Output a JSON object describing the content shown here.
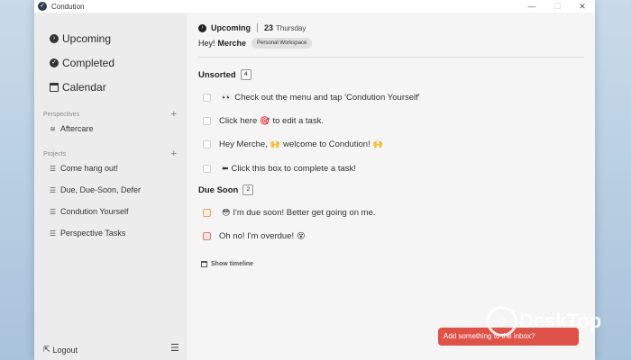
{
  "window": {
    "title": "Condution",
    "controls": {
      "minimize": "—",
      "maximize": "☐",
      "close": "✕"
    }
  },
  "sidebar": {
    "nav": [
      {
        "label": "Upcoming",
        "icon": "upcoming-icon"
      },
      {
        "label": "Completed",
        "icon": "completed-icon"
      },
      {
        "label": "Calendar",
        "icon": "calendar-icon"
      }
    ],
    "perspectives": {
      "heading": "Perspectives",
      "add": "+",
      "items": [
        {
          "label": "Aftercare",
          "icon": "layers-icon"
        }
      ]
    },
    "projects": {
      "heading": "Projects",
      "add": "+",
      "items": [
        {
          "label": "Come hang out!",
          "icon": "list-icon"
        },
        {
          "label": "Due, Due-Soon, Defer",
          "icon": "list-icon"
        },
        {
          "label": "Condution Yourself",
          "icon": "list-icon"
        },
        {
          "label": "Perspective Tasks",
          "icon": "list-icon"
        }
      ]
    },
    "logout": "Logout"
  },
  "header": {
    "title": "Upcoming",
    "day": "23",
    "weekday": "Thursday",
    "greeting": "Hey!",
    "user": "Merche",
    "workspace": "Personal Workspace"
  },
  "groups": {
    "unsorted": {
      "title": "Unsorted",
      "count": "4",
      "tasks": [
        {
          "pre": "👀",
          "text": "Check out the menu and tap 'Condution Yourself'",
          "post": ""
        },
        {
          "pre": "",
          "text": "Click here",
          "emoji": "🎯",
          "after": "to edit a task."
        },
        {
          "pre": "",
          "text": "Hey Merche,",
          "emoji": "🙌",
          "after": "welcome to Condution!",
          "post": "🙌"
        },
        {
          "pre": "⬅",
          "text": "Click this box to complete a task!",
          "post": ""
        }
      ]
    },
    "due_soon": {
      "title": "Due Soon",
      "count": "2",
      "tasks": [
        {
          "pre": "😳",
          "text": "I'm due soon! Better get going on me."
        },
        {
          "text": "Oh no! I'm overdue!",
          "post": "😵"
        }
      ]
    }
  },
  "timeline": "Show timeline",
  "inbox_button": "Add something to the inbox?",
  "watermark": "DeskTop",
  "colors": {
    "accent": "#de5248",
    "due_soon": "#e2a36a",
    "overdue": "#d97a7a"
  }
}
